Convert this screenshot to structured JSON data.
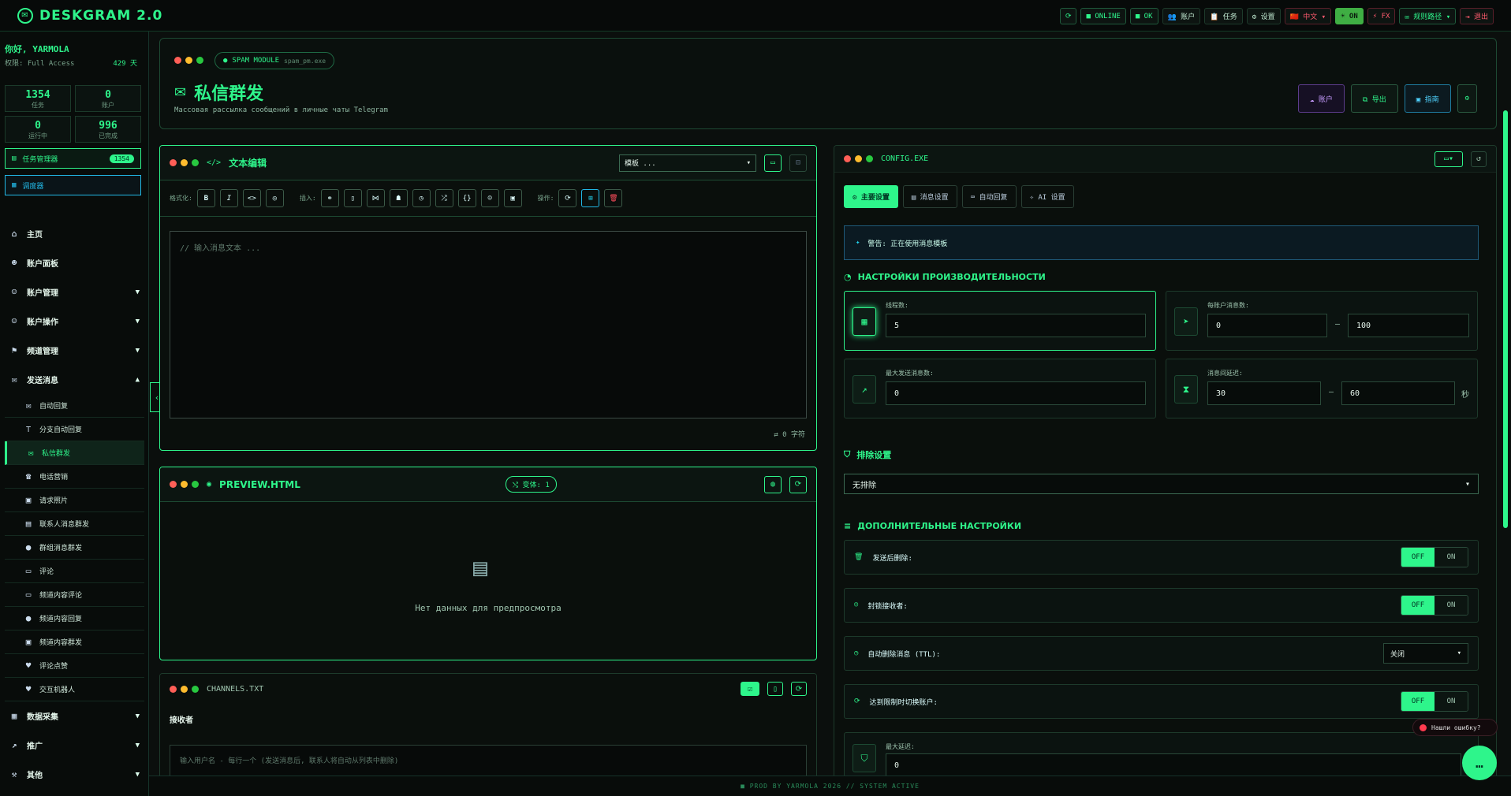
{
  "topbar": {
    "logo": "DESKGRAM 2.0",
    "items": [
      {
        "icon": "refresh-icon",
        "label": "⟳"
      },
      {
        "label": "■ ONLINE"
      },
      {
        "label": "■ OK"
      },
      {
        "label": "👥 账户"
      },
      {
        "label": "📋 任务"
      },
      {
        "label": "⚙ 设置"
      },
      {
        "label": "🇨🇳 中文 ▾"
      },
      {
        "label": "☀ ON"
      },
      {
        "label": "⚡ FX"
      },
      {
        "label": "✉ 规则路径 ▾"
      },
      {
        "label": "⇥ 退出"
      }
    ]
  },
  "sidebar": {
    "greeting": "你好, YARMOLA",
    "role": "权限: Full Access",
    "days": "429 天",
    "stats": [
      {
        "value": "1354",
        "label": "任务"
      },
      {
        "value": "0",
        "label": "账户"
      },
      {
        "value": "0",
        "label": "运行中"
      },
      {
        "value": "996",
        "label": "已完成"
      }
    ],
    "task_manager": "任务管理器",
    "task_count": "1354",
    "scheduled": "调度器",
    "nav": [
      {
        "label": "主页",
        "icon": "home-icon"
      },
      {
        "label": "账户面板",
        "icon": "users-icon"
      },
      {
        "label": "账户管理",
        "icon": "user-gear-icon",
        "arrow": "▼"
      },
      {
        "label": "账户操作",
        "icon": "user-edit-icon",
        "arrow": "▼"
      },
      {
        "label": "频道管理",
        "icon": "flag-icon",
        "arrow": "▼"
      },
      {
        "label": "发送消息",
        "icon": "chat-icon",
        "arrow": "▲"
      }
    ],
    "sub": [
      {
        "label": "自动回复",
        "icon": "mail-icon"
      },
      {
        "label": "分支自动回复",
        "icon": "tree-icon"
      },
      {
        "label": "私信群发",
        "icon": "envelope-icon",
        "active": true
      },
      {
        "label": "电话营销",
        "icon": "phone-icon"
      },
      {
        "label": "请求照片",
        "icon": "image-icon"
      },
      {
        "label": "联系人消息群发",
        "icon": "contacts-icon"
      },
      {
        "label": "群组消息群发",
        "icon": "group-chat-icon"
      },
      {
        "label": "评论",
        "icon": "comment-icon"
      },
      {
        "label": "频道内容评论",
        "icon": "channel-comment-icon"
      },
      {
        "label": "频道内容回复",
        "icon": "channel-reply-icon"
      },
      {
        "label": "频道内容群发",
        "icon": "channel-broadcast-icon"
      },
      {
        "label": "评论点赞",
        "icon": "heart-icon"
      },
      {
        "label": "交互机器人",
        "icon": "heart-bot-icon"
      }
    ],
    "nav2": [
      {
        "label": "数据采集",
        "icon": "database-icon",
        "arrow": "▼"
      },
      {
        "label": "推广",
        "icon": "chart-icon",
        "arrow": "▼"
      },
      {
        "label": "其他",
        "icon": "tools-icon",
        "arrow": "▼"
      }
    ]
  },
  "header": {
    "chip": "SPAM MODULE",
    "chip_file": "spam_pm.exe",
    "title": "私信群发",
    "subtitle": "Массовая рассылка сообщений в личные чаты Telegram",
    "buttons": [
      "☁ 账户",
      "⧉ 导出",
      "▣ 指南"
    ]
  },
  "editor": {
    "title": "文本编辑",
    "template": "模板 ...",
    "format_label": "格式化:",
    "insert_label": "插入:",
    "ops_label": "操作:",
    "placeholder": "// 输入消息文本 ...",
    "chars": "⇄ 0 字符"
  },
  "preview": {
    "title": "PREVIEW.HTML",
    "variants": "⤭ 变体: 1",
    "empty": "Нет данных для предпросмотра"
  },
  "channels": {
    "title": "CHANNELS.TXT",
    "label": "接收者",
    "placeholder": "输入用户名 - 每行一个 (发送消息后, 联系人将自动从列表中删除)"
  },
  "config": {
    "title": "CONFIG.EXE",
    "tabs": [
      "⚙ 主要设置",
      "▤ 消息设置",
      "⌨ 自动回复",
      "✧ AI 设置"
    ],
    "warning": "警告: 正在使用消息模板",
    "perf_title": "НАСТРОЙКИ ПРОИЗВОДИТЕЛЬНОСТИ",
    "threads_label": "线程数:",
    "threads": "5",
    "per_acc_label": "每账户消息数:",
    "per_acc_min": "0",
    "per_acc_max": "100",
    "max_label": "最大发送消息数:",
    "max": "0",
    "delay_label": "消息间延迟:",
    "delay_min": "30",
    "delay_max": "60",
    "delay_unit": "秒",
    "exclude_title": "排除设置",
    "exclude_value": "无排除",
    "extra_title": "ДОПОЛНИТЕЛЬНЫЕ НАСТРОЙКИ",
    "rows": [
      {
        "label": "发送后删除:",
        "icon": "trash-icon"
      },
      {
        "label": "封锁接收者:",
        "icon": "block-user-icon"
      },
      {
        "label": "自动删除消息 (TTL):",
        "icon": "clock-icon",
        "select": "关闭"
      },
      {
        "label": "达到限制时切换账户:",
        "icon": "cycle-icon"
      }
    ],
    "off": "OFF",
    "on": "ON",
    "max_delay_label": "最大延迟:",
    "max_delay": "0"
  },
  "footer": "■ PROD BY YARMOLA 2026   // SYSTEM ACTIVE",
  "bug": "Нашли ошибку?"
}
